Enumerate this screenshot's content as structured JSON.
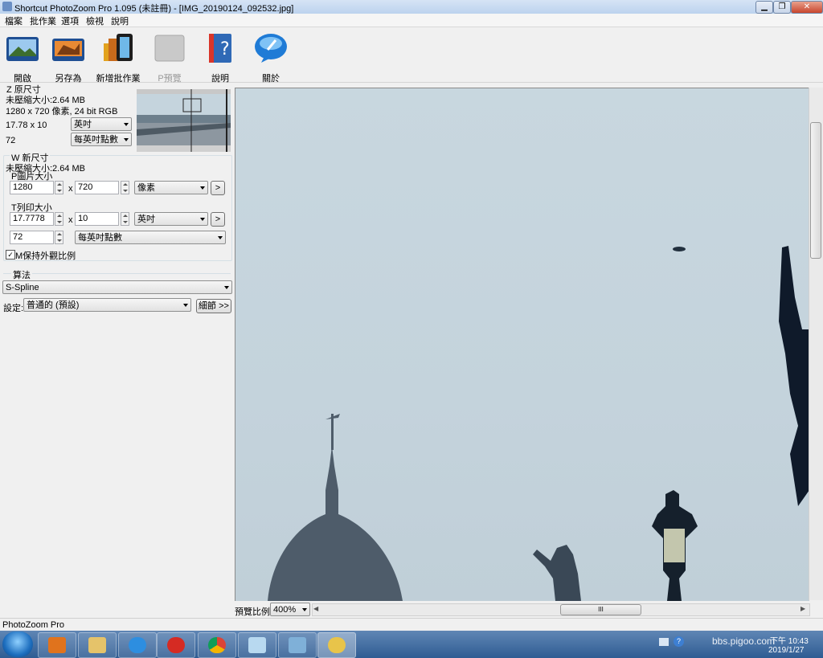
{
  "window": {
    "title": "Shortcut PhotoZoom Pro 1.095 (未註冊) - [IMG_20190124_092532.jpg]"
  },
  "menu": [
    "檔案",
    "批作業",
    "選項",
    "檢視",
    "說明"
  ],
  "toolbar": [
    {
      "label": "開啟",
      "icon": "open-image-icon",
      "enabled": true
    },
    {
      "label": "另存為",
      "icon": "save-as-icon",
      "enabled": true
    },
    {
      "label": "新增批作業",
      "icon": "batch-film-icon",
      "enabled": true
    },
    {
      "label": "P預覽",
      "icon": "preview-icon",
      "enabled": false
    },
    {
      "label": "說明",
      "icon": "help-icon",
      "enabled": true
    },
    {
      "label": "關於",
      "icon": "about-icon",
      "enabled": true
    }
  ],
  "original_size": {
    "header": "Z 原尺寸",
    "uncompressed": "未壓縮大小:2.64 MB",
    "pixels": "1280 x 720 像素, 24 bit RGB",
    "print_size": "17.78 x 10",
    "print_unit": "英吋",
    "resolution": "72",
    "resolution_unit": "每英吋點數"
  },
  "new_size": {
    "header": "W 新尺寸",
    "uncompressed": "未壓縮大小:2.64 MB",
    "pixel_header": "P圖片大小",
    "width_px": "1280",
    "x1": "x",
    "height_px": "720",
    "pixel_unit": "像素",
    "print_header": "T列印大小",
    "width_print": "17.7778",
    "x2": "x",
    "height_print": "10",
    "print_unit": "英吋",
    "resolution": "72",
    "resolution_unit": "每英吋點數",
    "keep_ratio": "M保持外觀比例",
    "go1": ">",
    "go2": ">"
  },
  "algorithm": {
    "header": "算法",
    "method": "S-Spline",
    "settings_label": "設定:",
    "preset": "普通的 (預設)",
    "details_button": "細節 >>"
  },
  "preview": {
    "zoom_label": "預覽比例:",
    "zoom_value": "400%",
    "h_thumb_grip": "III"
  },
  "status": {
    "text": "PhotoZoom Pro"
  },
  "taskbar": {
    "watermark": "bbs.pigoo.com",
    "time": "下午 10:43",
    "date": "2019/1/27"
  }
}
